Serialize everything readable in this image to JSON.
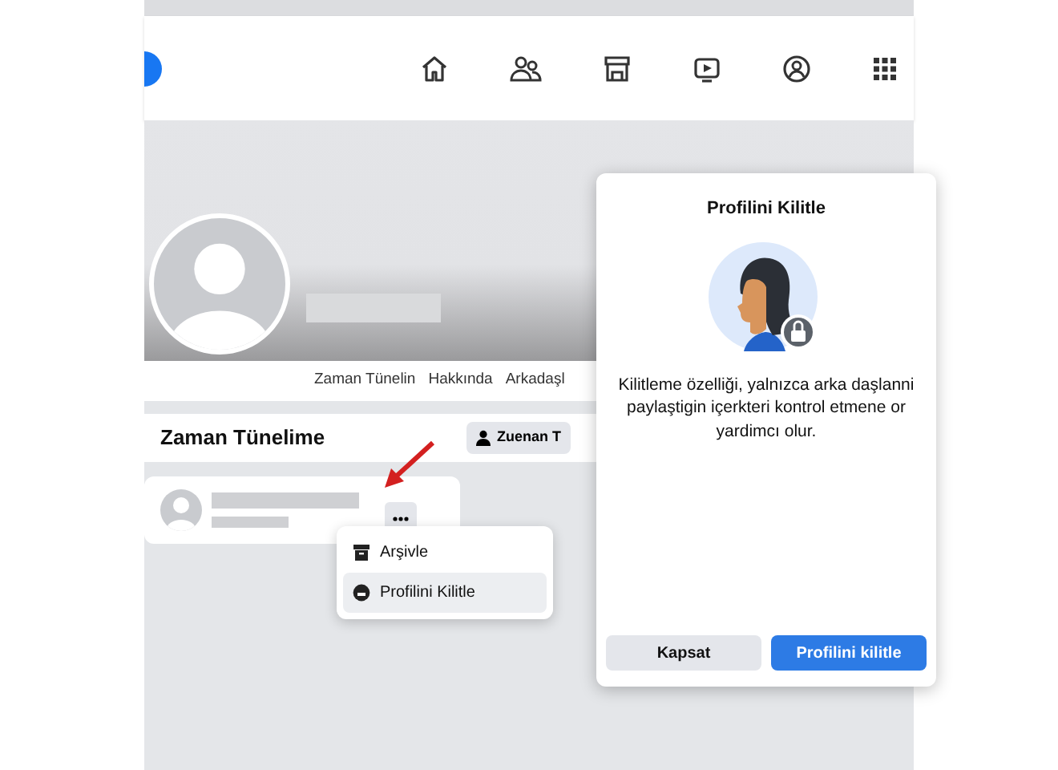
{
  "profile_tabs": [
    {
      "label": "Zaman Tünelin"
    },
    {
      "label": "Hakkında"
    },
    {
      "label": "Arkadaşl"
    }
  ],
  "timeline_header": {
    "title": "Zaman Tünelime",
    "button": "Zuenan T"
  },
  "post_menu": {
    "items": [
      {
        "label": "Arşivle",
        "kind": "archive",
        "selected": false
      },
      {
        "label": "Profilini Kilitle",
        "kind": "lock",
        "selected": true
      }
    ]
  },
  "lock_dialog": {
    "title": "Profilini Kilitle",
    "description": "Kilitleme özelliği, yalnızca arka daşlanni\npaylaştigin içerkteri kontrol etmene or\nyardimcı olur.",
    "buttons": [
      {
        "label": "Kapsat",
        "kind": "secondary"
      },
      {
        "label": "Profilini kilitle",
        "kind": "primary"
      }
    ]
  }
}
